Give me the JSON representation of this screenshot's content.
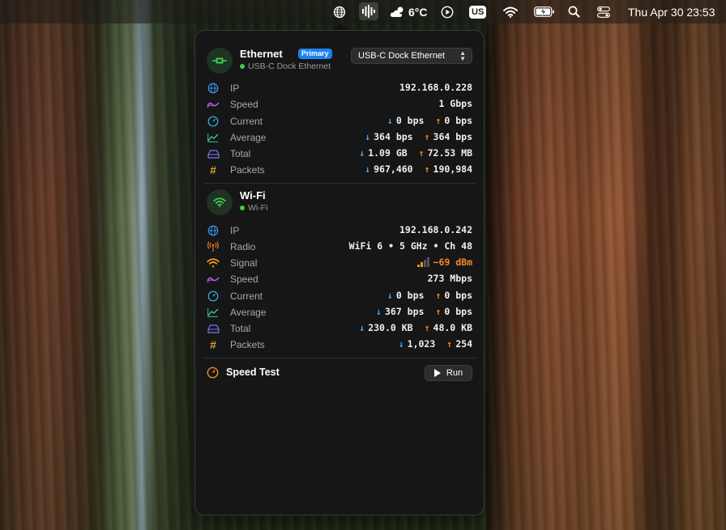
{
  "menubar": {
    "weather_temp": "6°C",
    "keyboard_layout": "US",
    "clock": "Thu Apr 30  23:53",
    "icons": [
      "globe-icon",
      "waveform-icon",
      "weather-cloud-moon-icon",
      "play-circle-icon",
      "keyboard-layout-icon",
      "wifi-icon",
      "battery-charging-icon",
      "search-icon",
      "control-center-icon"
    ]
  },
  "ethernet": {
    "title": "Ethernet",
    "badge": "Primary",
    "subtitle": "USB-C Dock Ethernet",
    "interface_select": "USB-C Dock Ethernet",
    "rows": {
      "ip": {
        "label": "IP",
        "value": "192.168.0.228"
      },
      "speed": {
        "label": "Speed",
        "value": "1 Gbps"
      },
      "current": {
        "label": "Current",
        "down": "0 bps",
        "up": "0 bps"
      },
      "average": {
        "label": "Average",
        "down": "364 bps",
        "up": "364 bps"
      },
      "total": {
        "label": "Total",
        "down": "1.09 GB",
        "up": "72.53 MB"
      },
      "packets": {
        "label": "Packets",
        "down": "967,460",
        "up": "190,984"
      }
    }
  },
  "wifi": {
    "title": "Wi-Fi",
    "subtitle": "Wi-Fi",
    "rows": {
      "ip": {
        "label": "IP",
        "value": "192.168.0.242"
      },
      "radio": {
        "label": "Radio",
        "value": "WiFi 6 • 5 GHz • Ch 48"
      },
      "signal": {
        "label": "Signal",
        "value": "−69 dBm",
        "bars_filled": 2,
        "bars_total": 4
      },
      "speed": {
        "label": "Speed",
        "value": "273 Mbps"
      },
      "current": {
        "label": "Current",
        "down": "0 bps",
        "up": "0 bps"
      },
      "average": {
        "label": "Average",
        "down": "367 bps",
        "up": "0 bps"
      },
      "total": {
        "label": "Total",
        "down": "230.0 KB",
        "up": "48.0 KB"
      },
      "packets": {
        "label": "Packets",
        "down": "1,023",
        "up": "254"
      }
    }
  },
  "speed_test": {
    "title": "Speed Test",
    "run_label": "Run"
  },
  "colors": {
    "download_arrow": "#42a8ff",
    "upload_arrow": "#f08a2a",
    "ethernet_accent": "#3ecb4f",
    "primary_badge": "#1b82f0",
    "panel_bg": "#151615"
  }
}
